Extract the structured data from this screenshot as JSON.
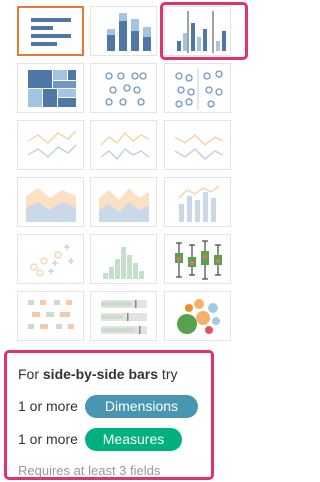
{
  "colors": {
    "blue_dark": "#4e79a7",
    "blue_light": "#a5c4e0",
    "orange": "#f5b06a",
    "green": "#59a14f",
    "dimension_pill": "#4996b2",
    "measure_pill": "#00b180",
    "highlight": "#e0326d",
    "active_border": "#e77a32"
  },
  "tiles": [
    {
      "name": "text-table",
      "row": 0,
      "col": 0,
      "state": "active"
    },
    {
      "name": "stacked-bars",
      "row": 0,
      "col": 1,
      "state": "enabled"
    },
    {
      "name": "side-by-side-bars",
      "row": 0,
      "col": 2,
      "state": "highlighted"
    },
    {
      "name": "treemap",
      "row": 1,
      "col": 0,
      "state": "enabled"
    },
    {
      "name": "circle-views",
      "row": 1,
      "col": 1,
      "state": "enabled"
    },
    {
      "name": "side-by-side-circles",
      "row": 1,
      "col": 2,
      "state": "enabled"
    },
    {
      "name": "lines-continuous",
      "row": 2,
      "col": 0,
      "state": "disabled"
    },
    {
      "name": "lines-discrete",
      "row": 2,
      "col": 1,
      "state": "disabled"
    },
    {
      "name": "dual-lines",
      "row": 2,
      "col": 2,
      "state": "disabled"
    },
    {
      "name": "area-continuous",
      "row": 3,
      "col": 0,
      "state": "disabled"
    },
    {
      "name": "area-discrete",
      "row": 3,
      "col": 1,
      "state": "disabled"
    },
    {
      "name": "dual-combination",
      "row": 3,
      "col": 2,
      "state": "disabled"
    },
    {
      "name": "scatter-plot",
      "row": 4,
      "col": 0,
      "state": "disabled"
    },
    {
      "name": "histogram",
      "row": 4,
      "col": 1,
      "state": "disabled"
    },
    {
      "name": "box-and-whisker",
      "row": 4,
      "col": 2,
      "state": "enabled"
    },
    {
      "name": "gantt-chart",
      "row": 5,
      "col": 0,
      "state": "disabled"
    },
    {
      "name": "bullet-graph",
      "row": 5,
      "col": 1,
      "state": "disabled"
    },
    {
      "name": "packed-bubbles",
      "row": 5,
      "col": 2,
      "state": "enabled"
    }
  ],
  "hint": {
    "prefix": "For ",
    "chart_name": "side-by-side bars",
    "suffix": " try",
    "line1_prefix": "1 or more",
    "line1_pill": "Dimensions",
    "line2_prefix": "1 or more",
    "line2_pill": "Measures",
    "footer": "Requires at least 3 fields"
  }
}
